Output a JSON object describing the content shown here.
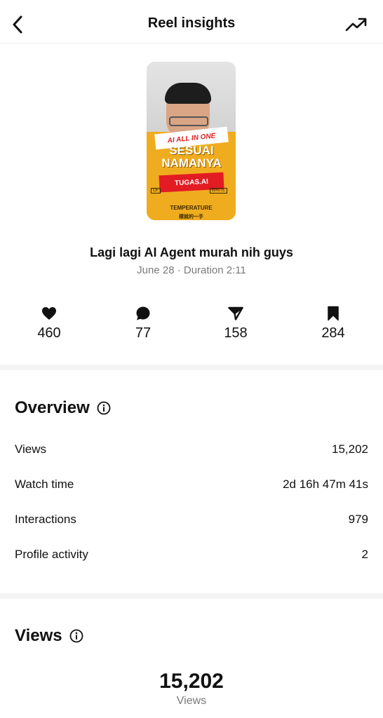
{
  "header": {
    "title": "Reel insights",
    "back_icon": "chevron-left-icon",
    "trend_icon": "trending-up-icon"
  },
  "reel": {
    "thumbnail": {
      "banner_white": "AI ALL IN ONE",
      "banner_big": "SESUAI NAMANYA",
      "banner_red": "TUGAS.AI",
      "shirt_left": "OF",
      "shirt_right": "WHITE",
      "shirt_text": "TEMPERATURE",
      "shirt_text_2": "樣就的一手"
    },
    "title": "Lagi lagi AI Agent murah nih guys",
    "meta": "June 28 · Duration 2:11"
  },
  "stats": [
    {
      "icon": "heart-icon",
      "value": "460"
    },
    {
      "icon": "comment-icon",
      "value": "77"
    },
    {
      "icon": "send-icon",
      "value": "158"
    },
    {
      "icon": "bookmark-icon",
      "value": "284"
    }
  ],
  "overview": {
    "title": "Overview",
    "rows": [
      {
        "label": "Views",
        "value": "15,202"
      },
      {
        "label": "Watch time",
        "value": "2d 16h 47m 41s"
      },
      {
        "label": "Interactions",
        "value": "979"
      },
      {
        "label": "Profile activity",
        "value": "2"
      }
    ]
  },
  "views_section": {
    "title": "Views",
    "total": "15,202",
    "total_label": "Views"
  },
  "colors": {
    "text": "#111111",
    "muted": "#7a7a7a",
    "divider": "#f4f4f4",
    "shirt": "#f0ac1f",
    "banner_red": "#e31b23"
  }
}
